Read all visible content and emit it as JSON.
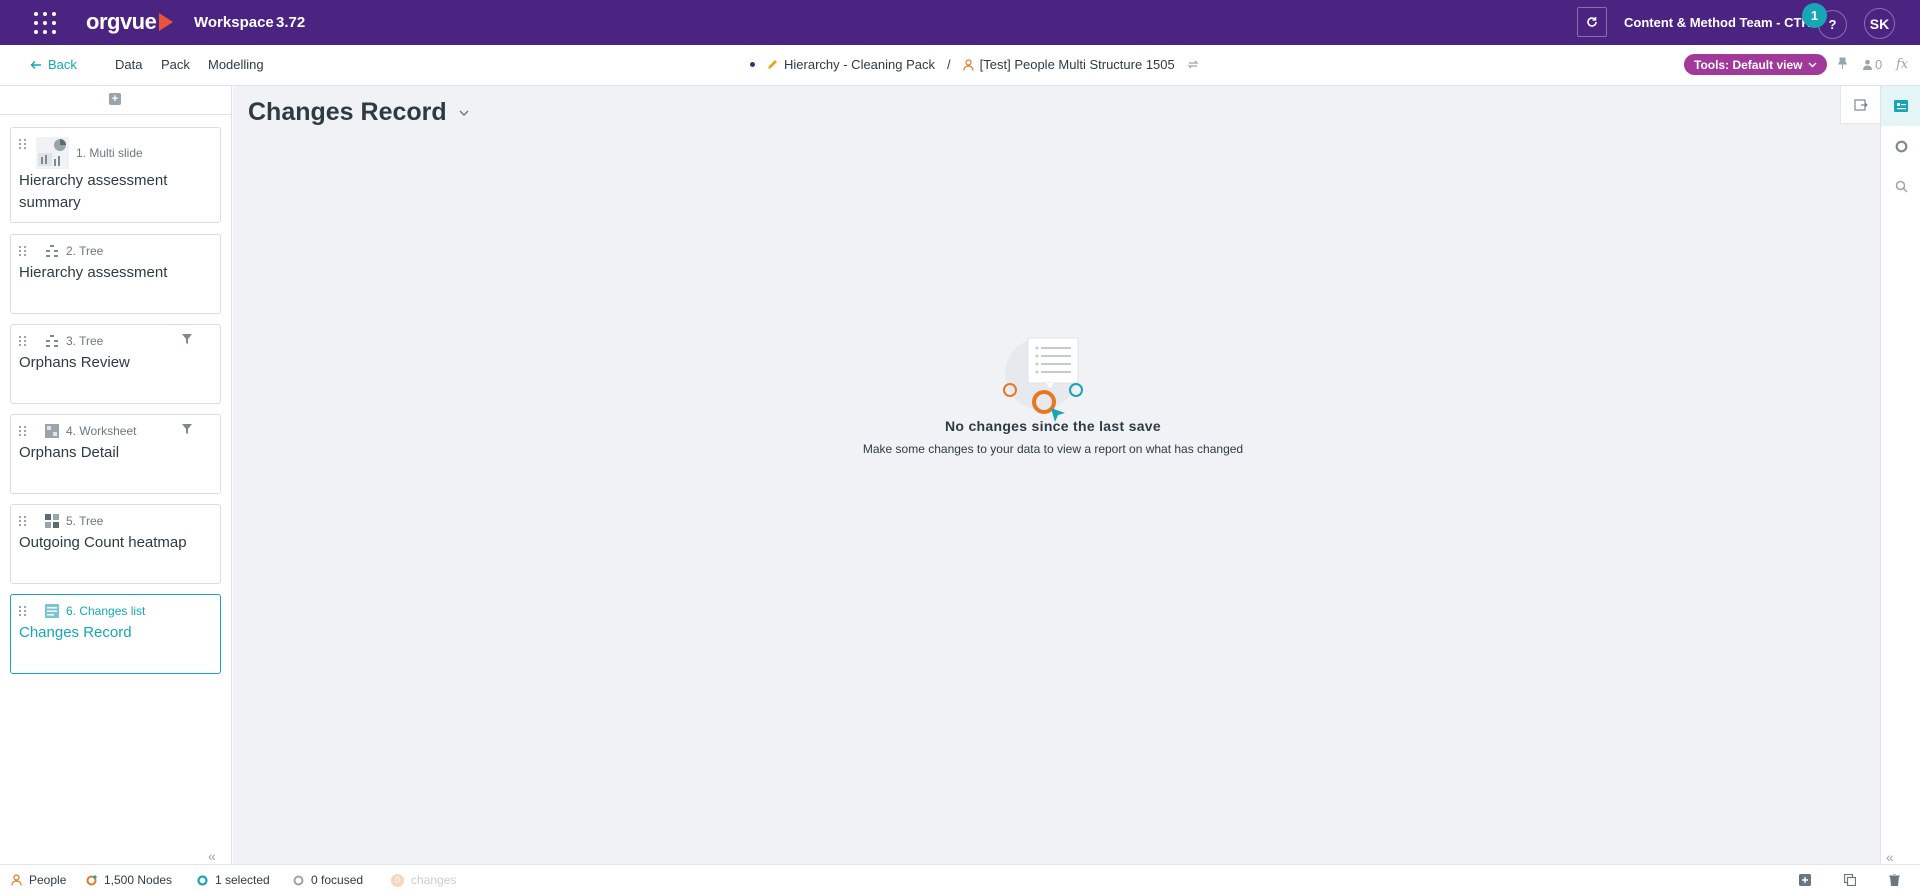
{
  "header": {
    "logo_text": "orgvue",
    "workspace_label": "Workspace",
    "version": "3.72",
    "team_name": "Content & Method Team - CTR",
    "notification_count": "1",
    "help_label": "?",
    "user_initials": "SK",
    "brand_color": "#4a2480",
    "accent_color": "#16a6b6"
  },
  "nav": {
    "back_label": "Back",
    "items": [
      "Data",
      "Pack",
      "Modelling"
    ],
    "breadcrumb": {
      "pack": "Hierarchy - Cleaning Pack",
      "separator": "/",
      "dataset": "[Test] People Multi Structure 1505"
    },
    "tools_label": "Tools: Default view",
    "user_count": "0",
    "fx_label": "fx"
  },
  "sidebar": {
    "slides": [
      {
        "type": "1. Multi slide",
        "title": "Hierarchy assessment summary",
        "icon": "multi-slide-icon",
        "filtered": false,
        "active": false
      },
      {
        "type": "2. Tree",
        "title": "Hierarchy assessment",
        "icon": "tree-icon",
        "filtered": false,
        "active": false
      },
      {
        "type": "3. Tree",
        "title": "Orphans Review",
        "icon": "tree-icon",
        "filtered": true,
        "active": false
      },
      {
        "type": "4. Worksheet",
        "title": "Orphans Detail",
        "icon": "worksheet-icon",
        "filtered": true,
        "active": false
      },
      {
        "type": "5. Tree",
        "title": "Outgoing Count heatmap",
        "icon": "heatmap-icon",
        "filtered": false,
        "active": false
      },
      {
        "type": "6. Changes list",
        "title": "Changes Record",
        "icon": "changes-list-icon",
        "filtered": false,
        "active": true
      }
    ]
  },
  "main": {
    "title": "Changes Record",
    "empty_title": "No changes since the last save",
    "empty_desc": "Make some changes to your data to view a report on what has changed"
  },
  "status": {
    "dataset": "People",
    "nodes": "1,500 Nodes",
    "selected": "1 selected",
    "focused": "0 focused",
    "changes_count": "0",
    "changes_label": "changes"
  }
}
